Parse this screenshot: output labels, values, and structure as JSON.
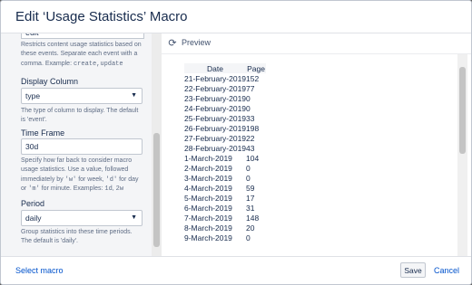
{
  "dialog": {
    "title": "Edit ‘Usage Statistics’ Macro"
  },
  "left": {
    "input_stub_value": "edit",
    "events_help_part1": "Restricts content usage statistics based on these events. Separate each event with a comma. Example: ",
    "events_help_code": "create,update",
    "display_column": {
      "label": "Display Column",
      "value": "type",
      "help": "The type of column to display. The default is 'event'."
    },
    "time_frame": {
      "label": "Time Frame",
      "value": "30d",
      "help_a": "Specify how far back to consider macro usage statistics. Use a value, followed immediately by ",
      "code_w": "'w'",
      "help_b": " for week, ",
      "code_d": "'d'",
      "help_c": " for day or ",
      "code_m": "'m'",
      "help_d": " for minute. Examples: ",
      "code_1d": "1d",
      "help_e": ", ",
      "code_2w": "2w"
    },
    "period": {
      "label": "Period",
      "value": "daily",
      "help": "Group statistics into these time periods. The default is 'daily'."
    }
  },
  "preview": {
    "label": "Preview",
    "columns": [
      "Date",
      "Page"
    ],
    "rows": [
      [
        "21-February-2019",
        "152"
      ],
      [
        "22-February-2019",
        "77"
      ],
      [
        "23-February-2019",
        "0"
      ],
      [
        "24-February-2019",
        "0"
      ],
      [
        "25-February-2019",
        "33"
      ],
      [
        "26-February-2019",
        "198"
      ],
      [
        "27-February-2019",
        "22"
      ],
      [
        "28-February-2019",
        "43"
      ],
      [
        "1-March-2019",
        "104"
      ],
      [
        "2-March-2019",
        "0"
      ],
      [
        "3-March-2019",
        "0"
      ],
      [
        "4-March-2019",
        "59"
      ],
      [
        "5-March-2019",
        "17"
      ],
      [
        "6-March-2019",
        "31"
      ],
      [
        "7-March-2019",
        "148"
      ],
      [
        "8-March-2019",
        "20"
      ],
      [
        "9-March-2019",
        "0"
      ]
    ]
  },
  "footer": {
    "select_macro": "Select macro",
    "save": "Save",
    "cancel": "Cancel"
  }
}
